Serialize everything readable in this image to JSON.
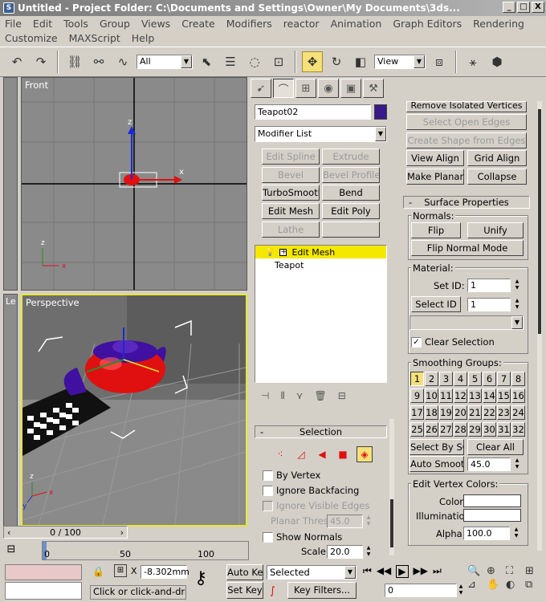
{
  "window": {
    "title": "Untitled    - Project Folder: C:\\Documents and Settings\\Owner\\My Documents\\3ds...",
    "min": "_",
    "max": "□",
    "close": "X"
  },
  "menu": {
    "row1": [
      "File",
      "Edit",
      "Tools",
      "Group",
      "Views",
      "Create",
      "Modifiers",
      "reactor",
      "Animation",
      "Graph Editors",
      "Rendering"
    ],
    "row2": [
      "Customize",
      "MAXScript",
      "Help"
    ]
  },
  "toolbar": {
    "filter_value": "All",
    "coord_system": "View"
  },
  "viewports": {
    "front_label": "Front",
    "perspective_label": "Perspective",
    "left_label": "Le",
    "axes": {
      "x": "x",
      "y": "y",
      "z": "z"
    }
  },
  "modify_panel": {
    "object_name": "Teapot02",
    "object_color": "#3a1a8a",
    "modifier_list": "Modifier List",
    "modifier_buttons": [
      {
        "label": "Edit Spline",
        "enabled": false
      },
      {
        "label": "Extrude",
        "enabled": false
      },
      {
        "label": "Bevel",
        "enabled": false
      },
      {
        "label": "Bevel Profile",
        "enabled": false
      },
      {
        "label": "TurboSmooth",
        "enabled": true
      },
      {
        "label": "Bend",
        "enabled": true
      },
      {
        "label": "Edit Mesh",
        "enabled": true
      },
      {
        "label": "Edit Poly",
        "enabled": true
      },
      {
        "label": "Lathe",
        "enabled": false
      },
      {
        "label": "",
        "enabled": false
      }
    ],
    "stack": [
      {
        "label": "Edit Mesh",
        "selected": true
      },
      {
        "label": "Teapot",
        "selected": false
      }
    ],
    "selection_rollout": {
      "title": "Selection",
      "by_vertex": "By Vertex",
      "ignore_backfacing": "Ignore Backfacing",
      "ignore_visible_edges": "Ignore Visible Edges",
      "planar_thresh_label": "Planar Thresh:",
      "planar_thresh_value": "45.0",
      "show_normals": "Show Normals",
      "scale_label": "Scale:",
      "scale_value": "20.0"
    }
  },
  "right_panel": {
    "remove_isolated": "Remove Isolated Vertices",
    "select_open_edges": "Select Open Edges",
    "create_shape": "Create Shape from Edges",
    "view_align": "View Align",
    "grid_align": "Grid Align",
    "make_planar": "Make Planar",
    "collapse": "Collapse",
    "surface_title": "Surface Properties",
    "normals_title": "Normals:",
    "flip": "Flip",
    "unify": "Unify",
    "flip_normal_mode": "Flip Normal Mode",
    "material_title": "Material:",
    "set_id_label": "Set ID:",
    "set_id_value": "1",
    "select_id": "Select ID",
    "select_id_value": "1",
    "clear_selection": "Clear Selection",
    "smoothing_title": "Smoothing Groups:",
    "smoothing_groups": [
      "1",
      "2",
      "3",
      "4",
      "5",
      "6",
      "7",
      "8",
      "9",
      "10",
      "11",
      "12",
      "13",
      "14",
      "15",
      "16",
      "17",
      "18",
      "19",
      "20",
      "21",
      "22",
      "23",
      "24",
      "25",
      "26",
      "27",
      "28",
      "29",
      "30",
      "31",
      "32"
    ],
    "select_by_sg": "Select By SG",
    "clear_all": "Clear All",
    "auto_smooth": "Auto Smooth",
    "auto_smooth_value": "45.0",
    "edit_vertex_colors_title": "Edit Vertex Colors:",
    "color_label": "Color:",
    "illumination_label": "Illumination:",
    "alpha_label": "Alpha:",
    "alpha_value": "100.0"
  },
  "timeline": {
    "frame_display": "0 / 100",
    "ticks": [
      "0",
      "50",
      "100"
    ]
  },
  "status": {
    "coord_x": "-8.302mm",
    "auto_key": "Auto Key",
    "set_key": "Set Key",
    "selected": "Selected",
    "key_filters": "Key Filters...",
    "frame_value": "0",
    "prompt": "Click or click-and-drag to"
  },
  "colors": {
    "viewport_bg": "#8a8a8a",
    "active_border": "#e8e830",
    "highlight": "#f6e07a",
    "teapot": "#e01010",
    "teapot_accent": "#4010a0"
  }
}
